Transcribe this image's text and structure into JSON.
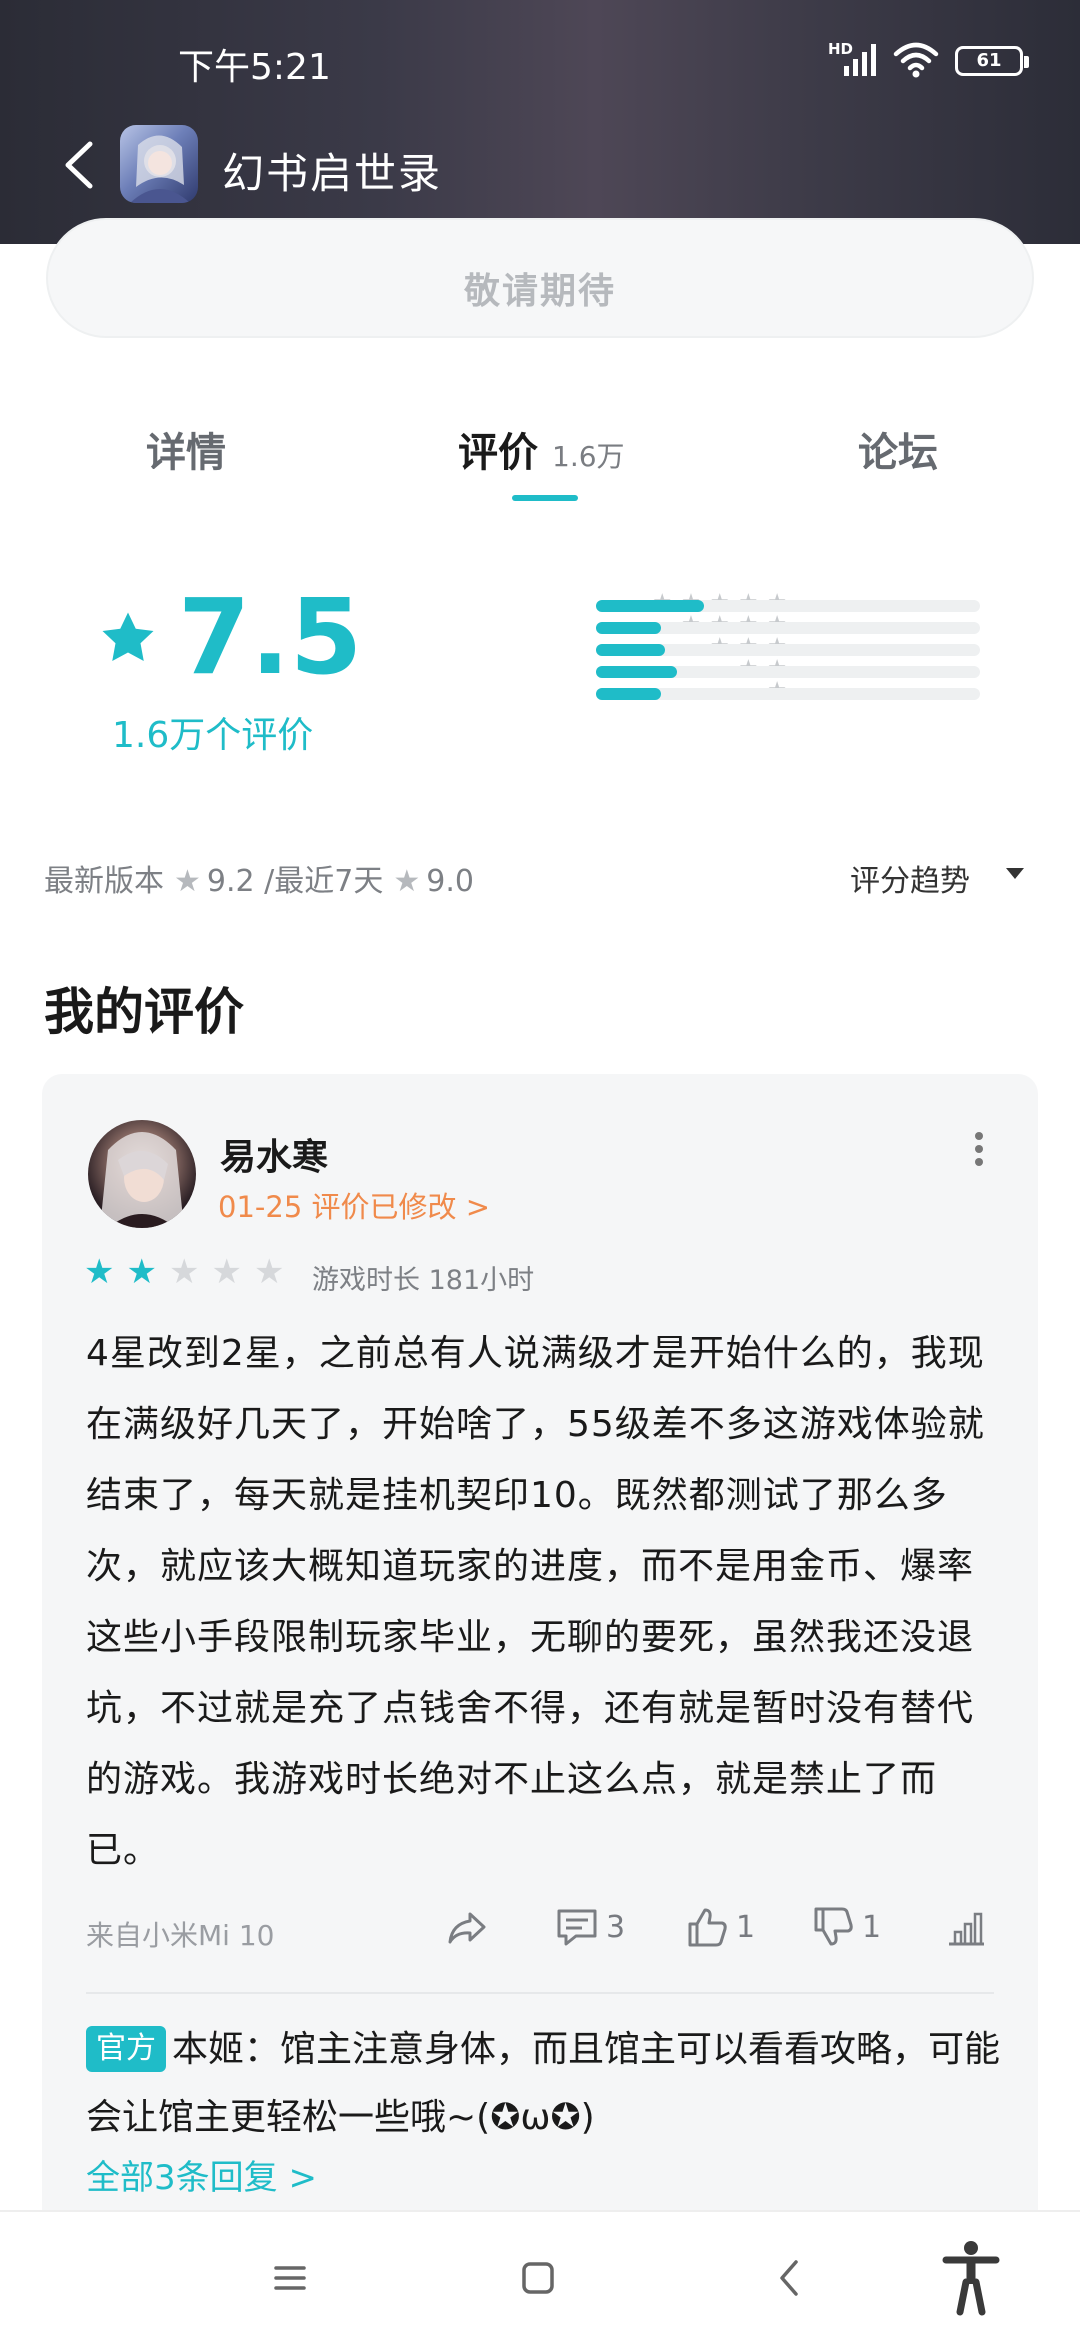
{
  "status_bar": {
    "time": "下午5:21",
    "hd": "HD",
    "battery": "61"
  },
  "header": {
    "title": "幻书启世录"
  },
  "action_button": {
    "label": "敬请期待"
  },
  "tabs": [
    {
      "label": "详情"
    },
    {
      "label": "评价",
      "count": "1.6万"
    },
    {
      "label": "论坛"
    }
  ],
  "rating": {
    "score": "7.5",
    "count_label": "1.6万个评价",
    "distribution": [
      {
        "stars": 5,
        "fraction": 0.28
      },
      {
        "stars": 4,
        "fraction": 0.17
      },
      {
        "stars": 3,
        "fraction": 0.18
      },
      {
        "stars": 2,
        "fraction": 0.21
      },
      {
        "stars": 1,
        "fraction": 0.17
      }
    ]
  },
  "version": {
    "latest_label": "最新版本",
    "latest_score": "9.2",
    "separator": "/",
    "recent_label": "最近7天",
    "recent_score": "9.0",
    "trend_label": "评分趋势"
  },
  "my_review": {
    "section_title": "我的评价",
    "user_name": "易水寒",
    "meta": "01-25 评价已修改 >",
    "stars": 2,
    "playtime": "游戏时长 181小时",
    "text": "4星改到2星，之前总有人说满级才是开始什么的，我现在满级好几天了，开始啥了，55级差不多这游戏体验就结束了，每天就是挂机契印10。既然都测试了那么多次，就应该大概知道玩家的进度，而不是用金币、爆率这些小手段限制玩家毕业，无聊的要死，虽然我还没退坑，不过就是充了点钱舍不得，还有就是暂时没有替代的游戏。我游戏时长绝对不止这么点，就是禁止了而已。",
    "device": "来自小米Mi 10",
    "comments": "3",
    "likes": "1",
    "dislikes": "1",
    "official_badge": "官方",
    "official_reply": "本姬：馆主注意身体，而且馆主可以看看攻略，可能会让馆主更轻松一些哦~(✪ω✪)",
    "all_replies": "全部3条回复 >"
  },
  "colors": {
    "accent": "#1fbcc8",
    "meta_orange": "#f08a4b"
  },
  "icons": [
    "back-icon",
    "app-icon",
    "star-icon",
    "share-icon",
    "comment-icon",
    "like-icon",
    "dislike-icon",
    "chart-icon",
    "more-icon",
    "menu-icon",
    "home-icon",
    "nav-back-icon",
    "accessibility-icon"
  ]
}
